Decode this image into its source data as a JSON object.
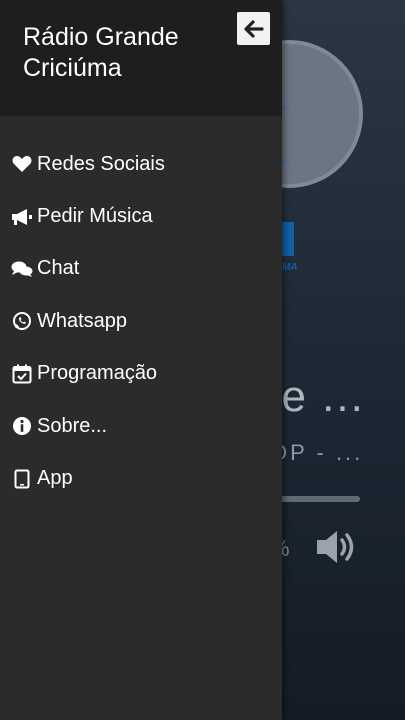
{
  "drawer": {
    "title": "Rádio Grande Criciúma",
    "menu": [
      {
        "icon": "heart-icon",
        "label": "Redes Sociais"
      },
      {
        "icon": "megaphone-icon",
        "label": "Pedir Música"
      },
      {
        "icon": "chat-icon",
        "label": "Chat"
      },
      {
        "icon": "whatsapp-icon",
        "label": "Whatsapp"
      },
      {
        "icon": "calendar-check-icon",
        "label": "Programação"
      },
      {
        "icon": "info-icon",
        "label": "Sobre..."
      },
      {
        "icon": "tablet-icon",
        "label": "App"
      }
    ]
  },
  "player": {
    "logo_tag": "MA",
    "now_playing_title": "de ...",
    "now_playing_subtitle": "OP - ...",
    "volume_text": "%"
  },
  "colors": {
    "drawer_bg": "#2b2b2b",
    "drawer_header_bg": "#1e1e1e",
    "accent_blue": "#1060a6"
  }
}
